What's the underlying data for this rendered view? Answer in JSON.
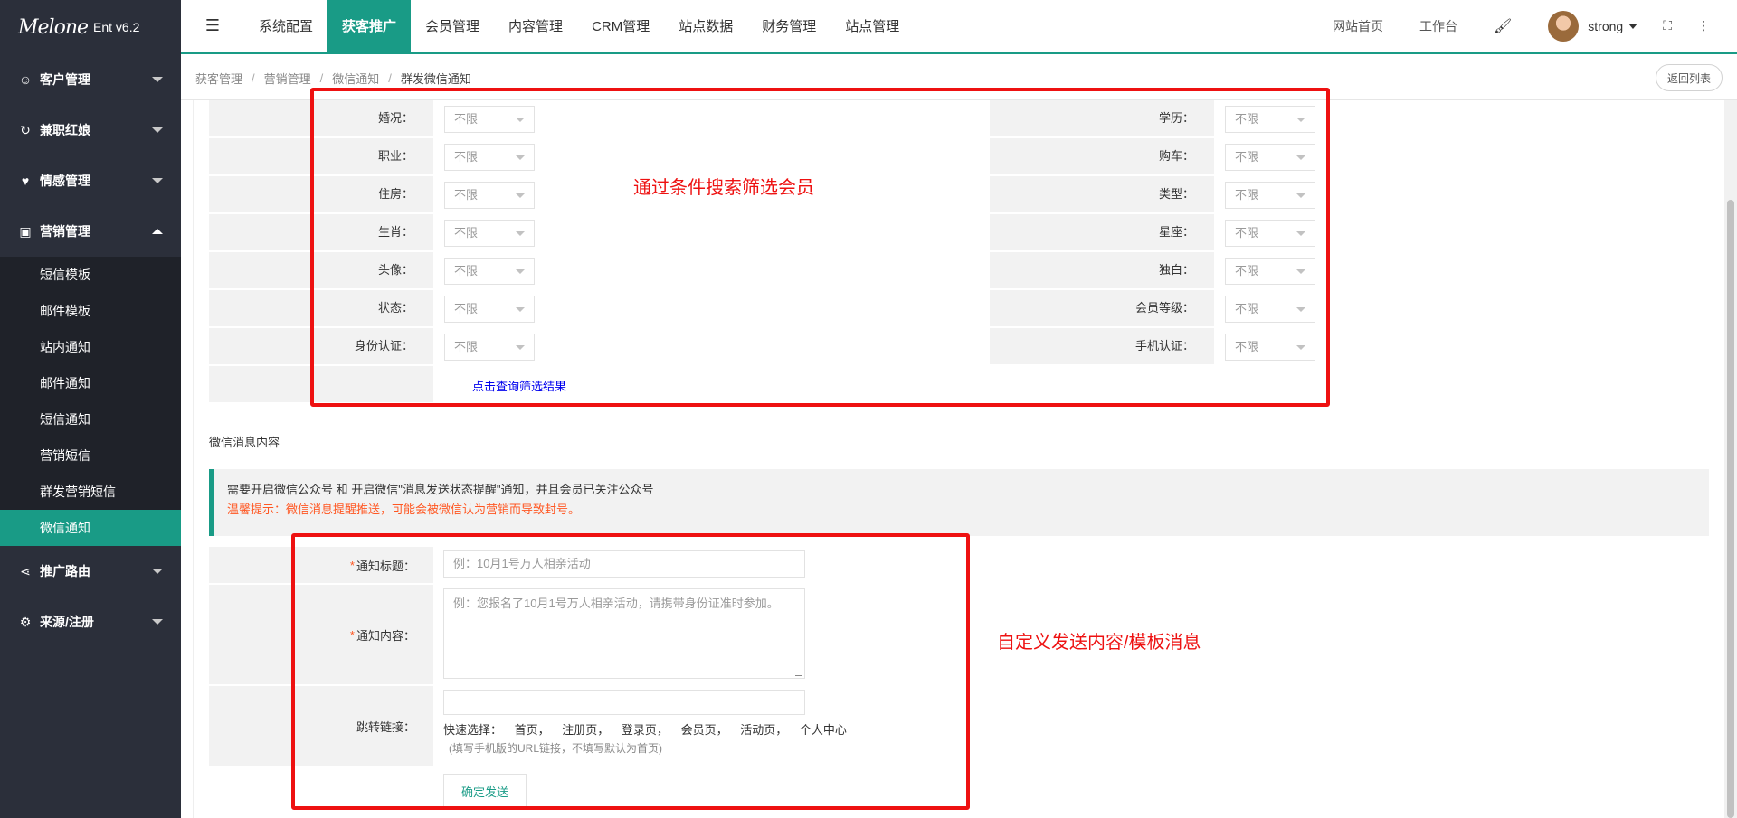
{
  "app": {
    "logo_text": "Melone",
    "version": "Ent v6.2"
  },
  "sidebar": {
    "groups": [
      {
        "label": "客户管理",
        "icon": "users-icon"
      },
      {
        "label": "兼职红娘",
        "icon": "handshake-icon"
      },
      {
        "label": "情感管理",
        "icon": "heart-icon"
      },
      {
        "label": "营销管理",
        "icon": "chart-icon"
      },
      {
        "label": "推广路由",
        "icon": "share-icon"
      },
      {
        "label": "来源/注册",
        "icon": "source-icon"
      }
    ],
    "submenu": [
      "短信模板",
      "邮件模板",
      "站内通知",
      "邮件通知",
      "短信通知",
      "营销短信",
      "群发营销短信",
      "微信通知"
    ]
  },
  "topnav": {
    "tabs": [
      "系统配置",
      "获客推广",
      "会员管理",
      "内容管理",
      "CRM管理",
      "站点数据",
      "财务管理",
      "站点管理"
    ],
    "active": "获客推广",
    "right_links": [
      "网站首页",
      "工作台"
    ],
    "username": "strong"
  },
  "breadcrumb": {
    "items": [
      "获客管理",
      "营销管理",
      "微信通知",
      "群发微信通知"
    ],
    "back": "返回列表"
  },
  "filters": {
    "left": [
      {
        "label": "婚况：",
        "value": "不限"
      },
      {
        "label": "职业：",
        "value": "不限"
      },
      {
        "label": "住房：",
        "value": "不限"
      },
      {
        "label": "生肖：",
        "value": "不限"
      },
      {
        "label": "头像：",
        "value": "不限"
      },
      {
        "label": "状态：",
        "value": "不限"
      },
      {
        "label": "身份认证：",
        "value": "不限"
      }
    ],
    "right": [
      {
        "label": "学历：",
        "value": "不限"
      },
      {
        "label": "购车：",
        "value": "不限"
      },
      {
        "label": "类型：",
        "value": "不限"
      },
      {
        "label": "星座：",
        "value": "不限"
      },
      {
        "label": "独白：",
        "value": "不限"
      },
      {
        "label": "会员等级：",
        "value": "不限"
      },
      {
        "label": "手机认证：",
        "value": "不限"
      }
    ],
    "query_link": "点击查询筛选结果"
  },
  "message": {
    "section_title": "微信消息内容",
    "notice": "需要开启微信公众号 和 开启微信\"消息发送状态提醒\"通知，并且会员已关注公众号",
    "warning": "温馨提示：微信消息提醒推送，可能会被微信认为营销而导致封号。",
    "title_label": "通知标题：",
    "title_placeholder": "例：10月1号万人相亲活动",
    "content_label": "通知内容：",
    "content_placeholder": "例：您报名了10月1号万人相亲活动，请携带身份证准时参加。",
    "link_label": "跳转链接：",
    "quick_label": "快速选择：",
    "quick_links": [
      "首页，",
      "注册页，",
      "登录页，",
      "会员页，",
      "活动页，",
      "个人中心"
    ],
    "hint": "(填写手机版的URL链接，不填写默认为首页)",
    "submit": "确定发送"
  },
  "annotations": {
    "filter": "通过条件搜索筛选会员",
    "custom": "自定义发送内容/模板消息"
  }
}
